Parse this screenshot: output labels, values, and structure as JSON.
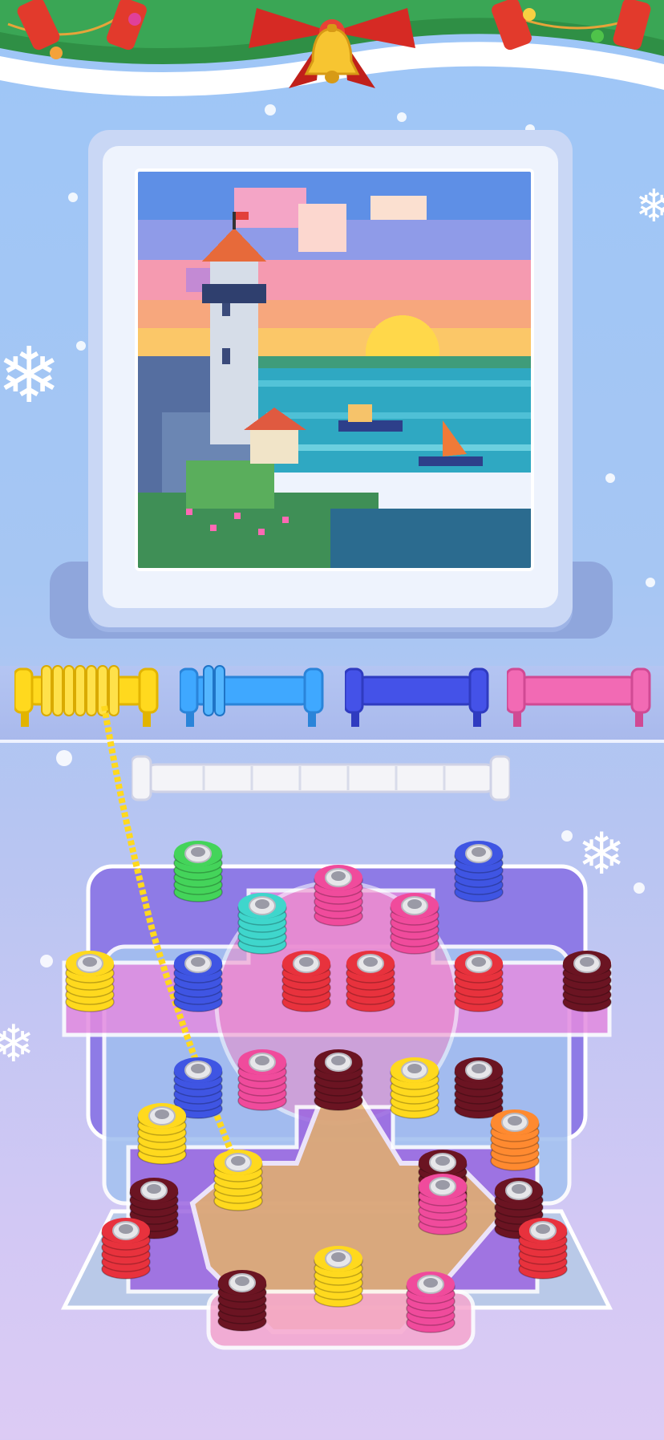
{
  "theme": {
    "sky_top": "#9ec6f7",
    "sky_bottom": "#dccbf4",
    "garland_green": "#2e9a4a",
    "ribbon_red": "#e23a2c",
    "bell_gold": "#f7c531"
  },
  "icons": [
    "bell-icon",
    "snowflake-icon"
  ],
  "collection_pegs": [
    {
      "color": "yellow",
      "hex": "#ffd91e",
      "filled": true
    },
    {
      "color": "blue",
      "hex": "#3fa8ff",
      "filled": true
    },
    {
      "color": "indigo",
      "hex": "#4452e8",
      "filled": false
    },
    {
      "color": "pink",
      "hex": "#f26ab4",
      "filled": false
    }
  ],
  "spare_peg": {
    "color": "white",
    "hex": "#f2f2f6"
  },
  "screw_colors": [
    "green",
    "blue",
    "pink",
    "yellow",
    "red",
    "maroon",
    "orange",
    "teal"
  ],
  "screws": [
    {
      "color": "#44d45a"
    },
    {
      "color": "#3f55e3"
    },
    {
      "color": "#f04b9c"
    },
    {
      "color": "#f04b9c"
    },
    {
      "color": "#ffd91e"
    },
    {
      "color": "#3f55e3"
    },
    {
      "color": "#e8323d"
    },
    {
      "color": "#e8323d"
    },
    {
      "color": "#e8323d"
    },
    {
      "color": "#6b1422"
    },
    {
      "color": "#3f55e3"
    },
    {
      "color": "#f04b9c"
    },
    {
      "color": "#6b1422"
    },
    {
      "color": "#ffd91e"
    },
    {
      "color": "#6b1422"
    },
    {
      "color": "#ffd91e"
    },
    {
      "color": "#ff8a30"
    },
    {
      "color": "#ffd91e"
    },
    {
      "color": "#6b1422"
    },
    {
      "color": "#f04b9c"
    },
    {
      "color": "#6b1422"
    },
    {
      "color": "#e8323d"
    },
    {
      "color": "#6b1422"
    },
    {
      "color": "#6b1422"
    },
    {
      "color": "#f04b9c"
    },
    {
      "color": "#e8323d"
    },
    {
      "color": "#3fd6cc"
    },
    {
      "color": "#ffd91e"
    }
  ]
}
